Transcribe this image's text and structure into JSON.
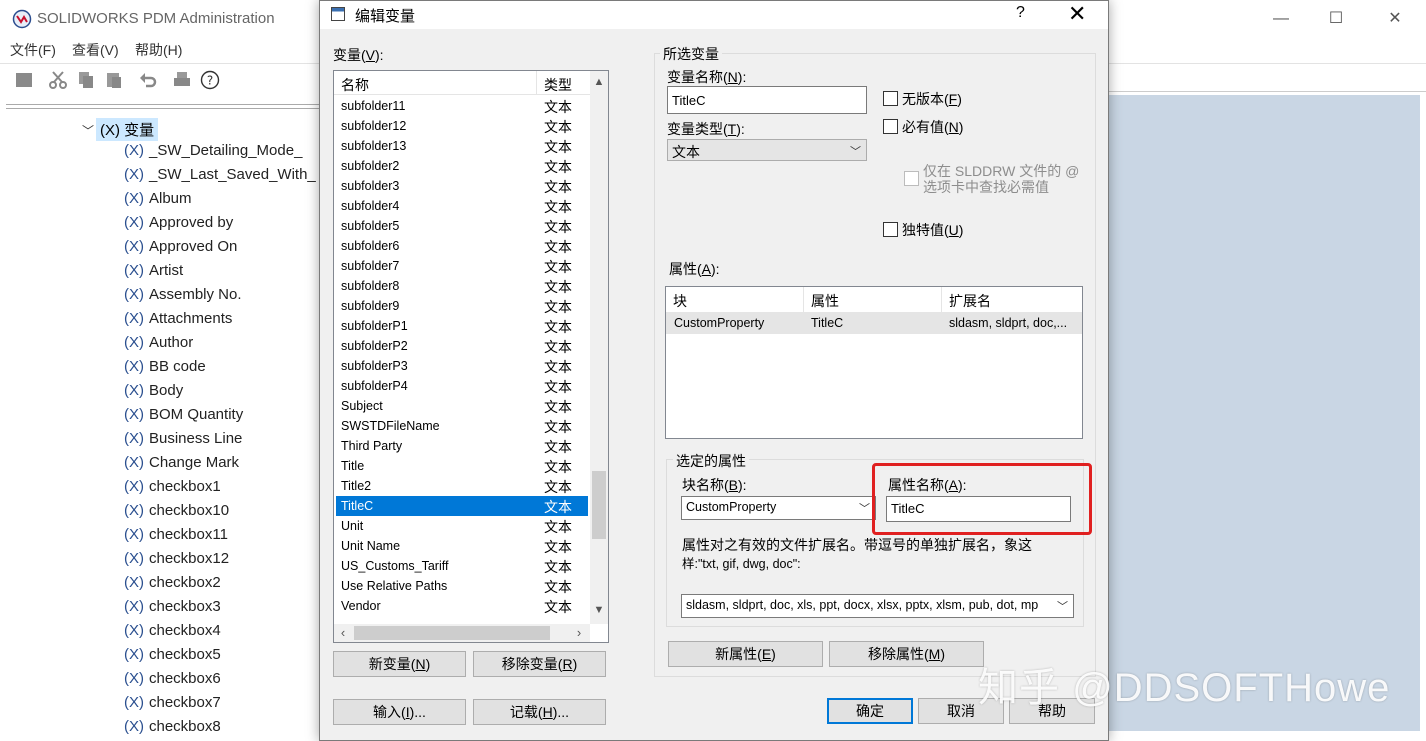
{
  "app": {
    "title": "SOLIDWORKS PDM Administration",
    "menu": [
      "文件(F)",
      "查看(V)",
      "帮助(H)"
    ],
    "tree_root": "(X) 变量",
    "tree_items": [
      "_SW_Detailing_Mode_",
      "_SW_Last_Saved_With_",
      "Album",
      "Approved by",
      "Approved On",
      "Artist",
      "Assembly No.",
      "Attachments",
      "Author",
      "BB code",
      "Body",
      "BOM Quantity",
      "Business Line",
      "Change Mark",
      "checkbox1",
      "checkbox10",
      "checkbox11",
      "checkbox12",
      "checkbox2",
      "checkbox3",
      "checkbox4",
      "checkbox5",
      "checkbox6",
      "checkbox7",
      "checkbox8"
    ],
    "tree_prefix": "(X)",
    "icons": [
      "minimize-icon",
      "maximize-icon",
      "close-icon"
    ]
  },
  "dialog": {
    "title": "编辑变量",
    "help_glyph": "?",
    "variables_label_prefix": "变量(",
    "variables_label_key": "V",
    "variables_label_suffix": "):",
    "list_header_name": "名称",
    "list_header_type": "类型",
    "list_rows": [
      {
        "name": "subfolder11",
        "type": "文本"
      },
      {
        "name": "subfolder12",
        "type": "文本"
      },
      {
        "name": "subfolder13",
        "type": "文本"
      },
      {
        "name": "subfolder2",
        "type": "文本"
      },
      {
        "name": "subfolder3",
        "type": "文本"
      },
      {
        "name": "subfolder4",
        "type": "文本"
      },
      {
        "name": "subfolder5",
        "type": "文本"
      },
      {
        "name": "subfolder6",
        "type": "文本"
      },
      {
        "name": "subfolder7",
        "type": "文本"
      },
      {
        "name": "subfolder8",
        "type": "文本"
      },
      {
        "name": "subfolder9",
        "type": "文本"
      },
      {
        "name": "subfolderP1",
        "type": "文本"
      },
      {
        "name": "subfolderP2",
        "type": "文本"
      },
      {
        "name": "subfolderP3",
        "type": "文本"
      },
      {
        "name": "subfolderP4",
        "type": "文本"
      },
      {
        "name": "Subject",
        "type": "文本"
      },
      {
        "name": "SWSTDFileName",
        "type": "文本"
      },
      {
        "name": "Third Party",
        "type": "文本"
      },
      {
        "name": "Title",
        "type": "文本"
      },
      {
        "name": "Title2",
        "type": "文本"
      },
      {
        "name": "TitleC",
        "type": "文本"
      },
      {
        "name": "Unit",
        "type": "文本"
      },
      {
        "name": "Unit Name",
        "type": "文本"
      },
      {
        "name": "US_Customs_Tariff",
        "type": "文本"
      },
      {
        "name": "Use Relative Paths",
        "type": "文本"
      },
      {
        "name": "Vendor",
        "type": "文本"
      }
    ],
    "selected_row": 20,
    "buttons": {
      "new_var": [
        "新变量(",
        "N",
        ")"
      ],
      "remove_var": [
        "移除变量(",
        "R",
        ")"
      ],
      "import": [
        "输入(",
        "I",
        ")..."
      ],
      "export": [
        "记载(",
        "H",
        ")..."
      ],
      "ok": "确定",
      "cancel": "取消",
      "help": "帮助",
      "new_attr": [
        "新属性(",
        "E",
        ")"
      ],
      "remove_attr": [
        "移除属性(",
        "M",
        ")"
      ]
    },
    "selected_var_group": "所选变量",
    "var_name_label": [
      "变量名称(",
      "N",
      "):"
    ],
    "var_name_value": "TitleC",
    "var_type_label": [
      "变量类型(",
      "T",
      "):"
    ],
    "var_type_value": "文本",
    "no_version": [
      "无版本(",
      "F",
      ")"
    ],
    "required": [
      "必有值(",
      "N",
      ")"
    ],
    "slddrw_line1": "仅在 SLDDRW 文件的 @",
    "slddrw_line2": "选项卡中查找必需值",
    "unique": [
      "独特值(",
      "U",
      ")"
    ],
    "attributes_label": [
      "属性(",
      "A",
      "):"
    ],
    "attr_headers": [
      "块",
      "属性",
      "扩展名"
    ],
    "attr_row": {
      "block": "CustomProperty",
      "attribute": "TitleC",
      "ext": "sldasm, sldprt, doc,..."
    },
    "selected_attr_group": "选定的属性",
    "block_name_label": [
      "块名称(",
      "B",
      "):"
    ],
    "block_name_value": "CustomProperty",
    "attr_name_label": [
      "属性名称(",
      "A",
      "):"
    ],
    "attr_name_value": "TitleC",
    "ext_desc_line1": "属性对之有效的文件扩展名。带逗号的单独扩展名，象这",
    "ext_desc_line2": "样:\"txt, gif, dwg, doc\":",
    "ext_value": "sldasm, sldprt, doc, xls, ppt, docx, xlsx, pptx, xlsm, pub, dot, mp"
  },
  "watermark": "知乎 @DDSOFTHowe",
  "colors": {
    "selection": "#0078d7",
    "tree_selection": "#cce8ff",
    "highlight_box": "#e02020",
    "right_pane": "#c9d6e4"
  }
}
